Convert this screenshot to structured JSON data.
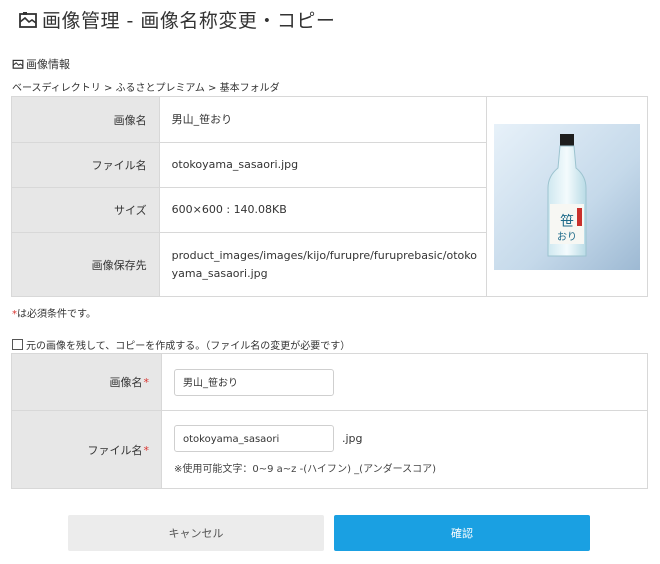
{
  "page": {
    "title": "画像管理 - 画像名称変更・コピー",
    "section_label": "画像情報",
    "breadcrumb": "ベースディレクトリ > ふるさとプレミアム > 基本フォルダ"
  },
  "info": {
    "rows": [
      {
        "label": "画像名",
        "value": "男山_笹おり"
      },
      {
        "label": "ファイル名",
        "value": "otokoyama_sasaori.jpg"
      },
      {
        "label": "サイズ",
        "value": "600×600 : 140.08KB"
      },
      {
        "label": "画像保存先",
        "value": "product_images/images/kijo/furupre/furuprebasic/otokoyama_sasaori.jpg"
      }
    ]
  },
  "required_note": {
    "star": "*",
    "text": "は必須条件です。"
  },
  "copy_option": {
    "label": "元の画像を残して、コピーを作成する。（ファイル名の変更が必要です）",
    "checked": false
  },
  "form": {
    "image_name_label": "画像名",
    "image_name_value": "男山_笹おり",
    "file_name_label": "ファイル名",
    "file_name_value": "otokoyama_sasaori",
    "extension": ".jpg",
    "hint": "※使用可能文字：0~9 a~z -(ハイフン) _(アンダースコア)",
    "required_star": "*"
  },
  "buttons": {
    "cancel": "キャンセル",
    "confirm": "確認"
  },
  "colors": {
    "accent": "#1aa0e2",
    "required": "#d9332e",
    "label_bg": "#e7e7e7"
  }
}
